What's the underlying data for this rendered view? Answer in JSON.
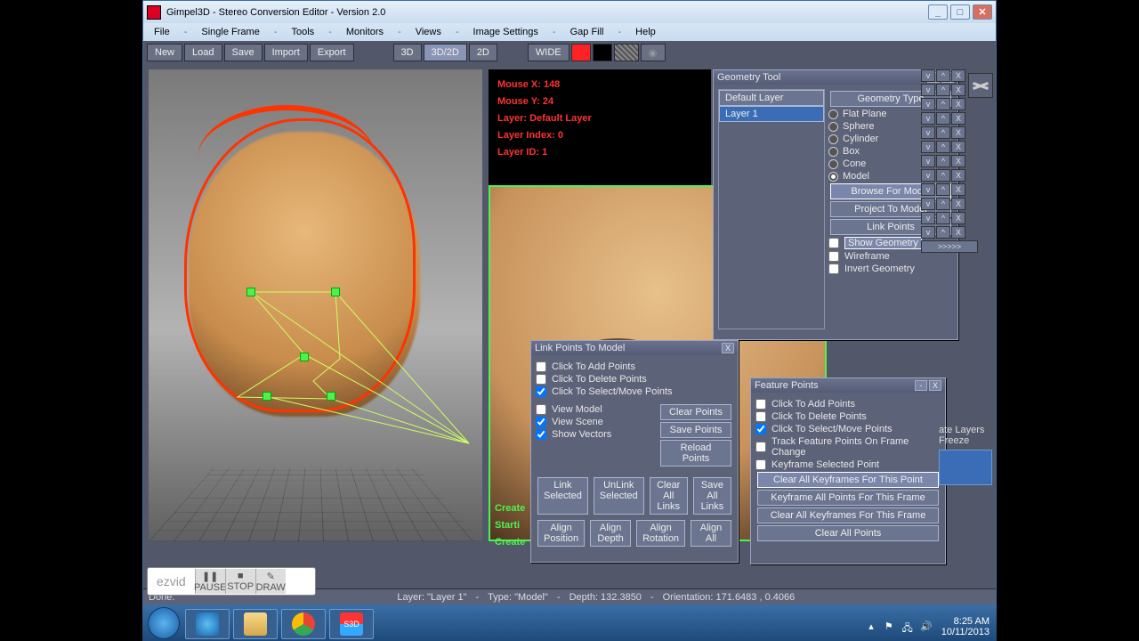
{
  "window": {
    "title": "Gimpel3D - Stereo Conversion Editor - Version 2.0"
  },
  "menus": [
    "File",
    "Single Frame",
    "Tools",
    "Monitors",
    "Views",
    "Image Settings",
    "Gap Fill",
    "Help"
  ],
  "toolbar": {
    "new": "New",
    "load": "Load",
    "save": "Save",
    "import": "Import",
    "export": "Export",
    "m3d": "3D",
    "m3d2d": "3D/2D",
    "m2d": "2D",
    "wide": "WIDE"
  },
  "info": {
    "mx": "Mouse X: 148",
    "my": "Mouse Y: 24",
    "layer": "Layer: Default Layer",
    "lidx": "Layer Index: 0",
    "lid": "Layer ID: 1"
  },
  "create": {
    "l1": "Create",
    "l2": "Starti",
    "l3": "Create"
  },
  "status": {
    "done": "Done.",
    "layer": "Layer: \"Layer 1\"",
    "type": "Type: \"Model\"",
    "depth": "Depth: 132.3850",
    "orient": "Orientation: 171.6483 , 0.4066"
  },
  "geotool": {
    "title": "Geometry Tool",
    "default": "Default Layer",
    "layer1": "Layer 1",
    "typehdr": "Geometry Type",
    "types": [
      "Flat Plane",
      "Sphere",
      "Cylinder",
      "Box",
      "Cone",
      "Model"
    ],
    "browse": "Browse For Model",
    "project": "Project To Model",
    "link": "Link Points",
    "showgeo": "Show Geometry",
    "wire": "Wireframe",
    "invert": "Invert Geometry"
  },
  "linkp": {
    "title": "Link Points To Model",
    "add": "Click To Add Points",
    "del": "Click To Delete Points",
    "sel": "Click To Select/Move Points",
    "vm": "View Model",
    "vs": "View Scene",
    "sv": "Show Vectors",
    "clear": "Clear Points",
    "save": "Save Points",
    "reload": "Reload Points",
    "linksel": "Link Selected",
    "unlink": "UnLink Selected",
    "clearall": "Clear All Links",
    "saveall": "Save All Links",
    "apos": "Align Position",
    "adep": "Align Depth",
    "arot": "Align Rotation",
    "aall": "Align All"
  },
  "feat": {
    "title": "Feature Points",
    "add": "Click To Add Points",
    "del": "Click To Delete Points",
    "sel": "Click To Select/Move Points",
    "track": "Track Feature Points On Frame Change",
    "kf": "Keyframe Selected Point",
    "b1": "Clear All Keyframes For This Point",
    "b2": "Keyframe All Points For This Frame",
    "b3": "Clear All Keyframes For This Frame",
    "b4": "Clear All Points"
  },
  "side": {
    "arrow": ">>>>>",
    "ate": "ate Layers",
    "freeze": "Freeze"
  },
  "recorder": {
    "pause": "PAUSE",
    "stop": "STOP",
    "draw": "DRAW",
    "logo": "ezvid"
  },
  "tray": {
    "time": "8:25 AM",
    "date": "10/11/2013"
  }
}
